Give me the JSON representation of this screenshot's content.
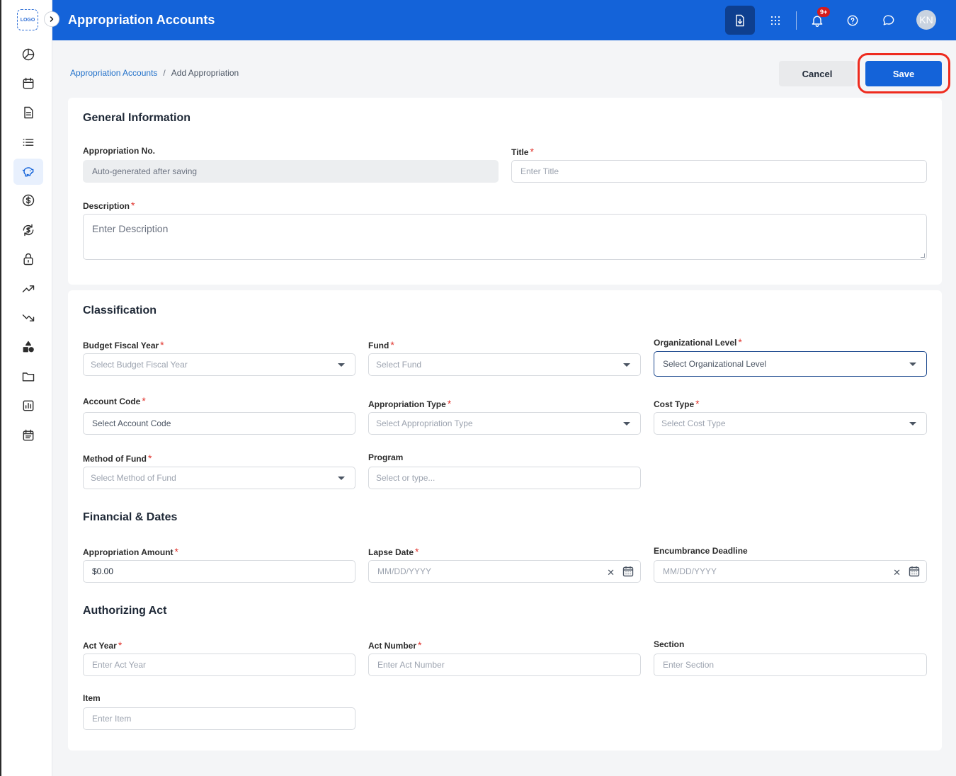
{
  "app": {
    "logo_text": "LOGO"
  },
  "header": {
    "title": "Appropriation Accounts",
    "notification_badge": "9+",
    "avatar_initials": "KN"
  },
  "sidebar": {
    "items": [
      {
        "icon": "pie-chart-icon"
      },
      {
        "icon": "calendar-icon"
      },
      {
        "icon": "document-icon"
      },
      {
        "icon": "list-icon"
      },
      {
        "icon": "piggy-bank-icon",
        "active": true
      },
      {
        "icon": "dollar-icon"
      },
      {
        "icon": "dollar-refresh-icon"
      },
      {
        "icon": "lock-icon"
      },
      {
        "icon": "trending-up-icon"
      },
      {
        "icon": "trending-down-icon"
      },
      {
        "icon": "shapes-icon"
      },
      {
        "icon": "folder-icon"
      },
      {
        "icon": "bar-chart-icon"
      },
      {
        "icon": "calendar-list-icon"
      }
    ]
  },
  "breadcrumb": {
    "parent": "Appropriation Accounts",
    "separator": "/",
    "current": "Add Appropriation"
  },
  "actions": {
    "cancel_label": "Cancel",
    "save_label": "Save"
  },
  "general": {
    "title": "General Information",
    "appropriation_no": {
      "label": "Appropriation No.",
      "value": "Auto-generated after saving"
    },
    "title_field": {
      "label": "Title",
      "placeholder": "Enter Title"
    },
    "description": {
      "label": "Description",
      "placeholder": "Enter Description"
    }
  },
  "classification": {
    "title": "Classification",
    "budget_fiscal_year": {
      "label": "Budget Fiscal Year",
      "placeholder": "Select Budget Fiscal Year"
    },
    "fund": {
      "label": "Fund",
      "placeholder": "Select Fund"
    },
    "org_level": {
      "label": "Organizational Level",
      "placeholder": "Select Organizational Level"
    },
    "account_code": {
      "label": "Account Code",
      "placeholder": "Select Account Code"
    },
    "appropriation_type": {
      "label": "Appropriation Type",
      "placeholder": "Select Appropriation Type"
    },
    "cost_type": {
      "label": "Cost Type",
      "placeholder": "Select Cost Type"
    },
    "method_of_fund": {
      "label": "Method of Fund",
      "placeholder": "Select Method of Fund"
    },
    "program": {
      "label": "Program",
      "placeholder": "Select or type..."
    }
  },
  "financial": {
    "title": "Financial & Dates",
    "amount": {
      "label": "Appropriation Amount",
      "value": "$0.00"
    },
    "lapse_date": {
      "label": "Lapse Date",
      "placeholder": "MM/DD/YYYY"
    },
    "encumbrance_deadline": {
      "label": "Encumbrance Deadline",
      "placeholder": "MM/DD/YYYY"
    }
  },
  "authorizing": {
    "title": "Authorizing Act",
    "act_year": {
      "label": "Act Year",
      "placeholder": "Enter Act Year"
    },
    "act_number": {
      "label": "Act Number",
      "placeholder": "Enter Act Number"
    },
    "section": {
      "label": "Section",
      "placeholder": "Enter Section"
    },
    "item": {
      "label": "Item",
      "placeholder": "Enter Item"
    }
  },
  "colors": {
    "primary": "#1463d9",
    "required": "#e0312a",
    "highlight": "#ee2b1e"
  }
}
